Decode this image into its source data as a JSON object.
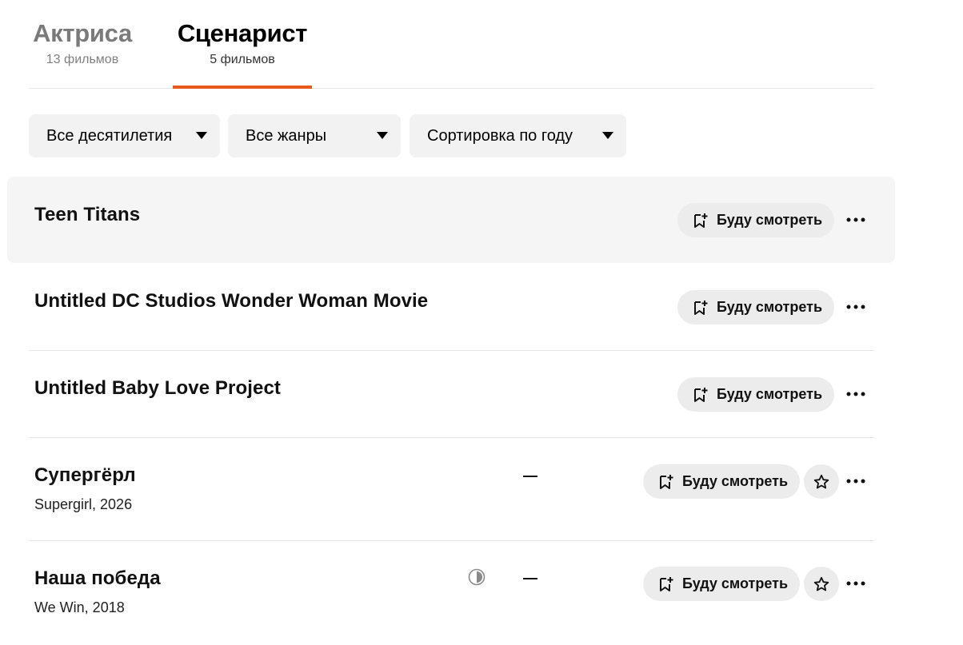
{
  "tabs": [
    {
      "title": "Актриса",
      "count": "13 фильмов"
    },
    {
      "title": "Сценарист",
      "count": "5 фильмов"
    }
  ],
  "filters": {
    "decades": "Все десятилетия",
    "genres": "Все жанры",
    "sort": "Сортировка по году"
  },
  "films": [
    {
      "title": "Teen Titans",
      "watch_label": "Буду смотреть"
    },
    {
      "title": "Untitled DC Studios Wonder Woman Movie",
      "watch_label": "Буду смотреть"
    },
    {
      "title": "Untitled Baby Love Project",
      "watch_label": "Буду смотреть"
    },
    {
      "title": "Супергёрл",
      "subtitle": "Supergirl, 2026",
      "rating": "—",
      "watch_label": "Буду смотреть"
    },
    {
      "title": "Наша победа",
      "subtitle": "We Win, 2018",
      "rating": "—",
      "watch_label": "Буду смотреть"
    }
  ],
  "colors": {
    "accent": "#e85a1c",
    "button_bg": "#ececec",
    "filter_bg": "#f2f2f2"
  },
  "icons": [
    "bookmark-plus-icon",
    "star-icon",
    "more-dots-icon",
    "half-circle-rating-icon",
    "caret-down-icon"
  ]
}
